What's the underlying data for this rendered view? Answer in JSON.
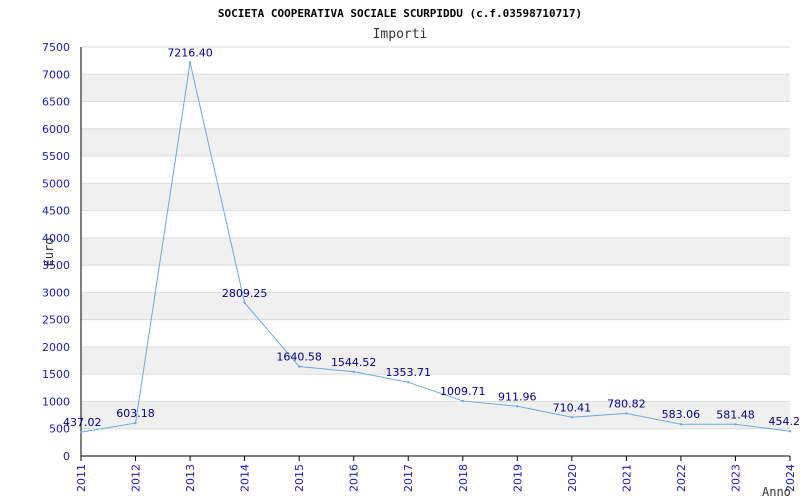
{
  "chart_data": {
    "type": "line",
    "title": "SOCIETA COOPERATIVA SOCIALE SCURPIDDU (c.f.03598710717)",
    "subtitle": "Importi",
    "xlabel": "Anno",
    "ylabel": "Euro",
    "x": [
      "2011",
      "2012",
      "2013",
      "2014",
      "2015",
      "2016",
      "2017",
      "2018",
      "2019",
      "2020",
      "2021",
      "2022",
      "2023",
      "2024"
    ],
    "values": [
      437.02,
      603.18,
      7216.4,
      2809.25,
      1640.58,
      1544.52,
      1353.71,
      1009.71,
      911.96,
      710.41,
      780.82,
      583.06,
      581.48,
      454.2
    ],
    "data_labels": [
      "437.02",
      "603.18",
      "7216.40",
      "2809.25",
      "1640.58",
      "1544.52",
      "1353.71",
      "1009.71",
      "911.96",
      "710.41",
      "780.82",
      "583.06",
      "581.48",
      "454.2"
    ],
    "y_ticks": [
      "0",
      "500",
      "1000",
      "1500",
      "2000",
      "2500",
      "3000",
      "3500",
      "4000",
      "4500",
      "5000",
      "5500",
      "6000",
      "6500",
      "7000",
      "7500"
    ],
    "ylim": [
      0,
      7500
    ],
    "grid": true,
    "band_color": "#f0f0f0",
    "line_color": "#6aa9e6",
    "label_color": "#00008b",
    "tick_color": "#1c1cb0"
  }
}
